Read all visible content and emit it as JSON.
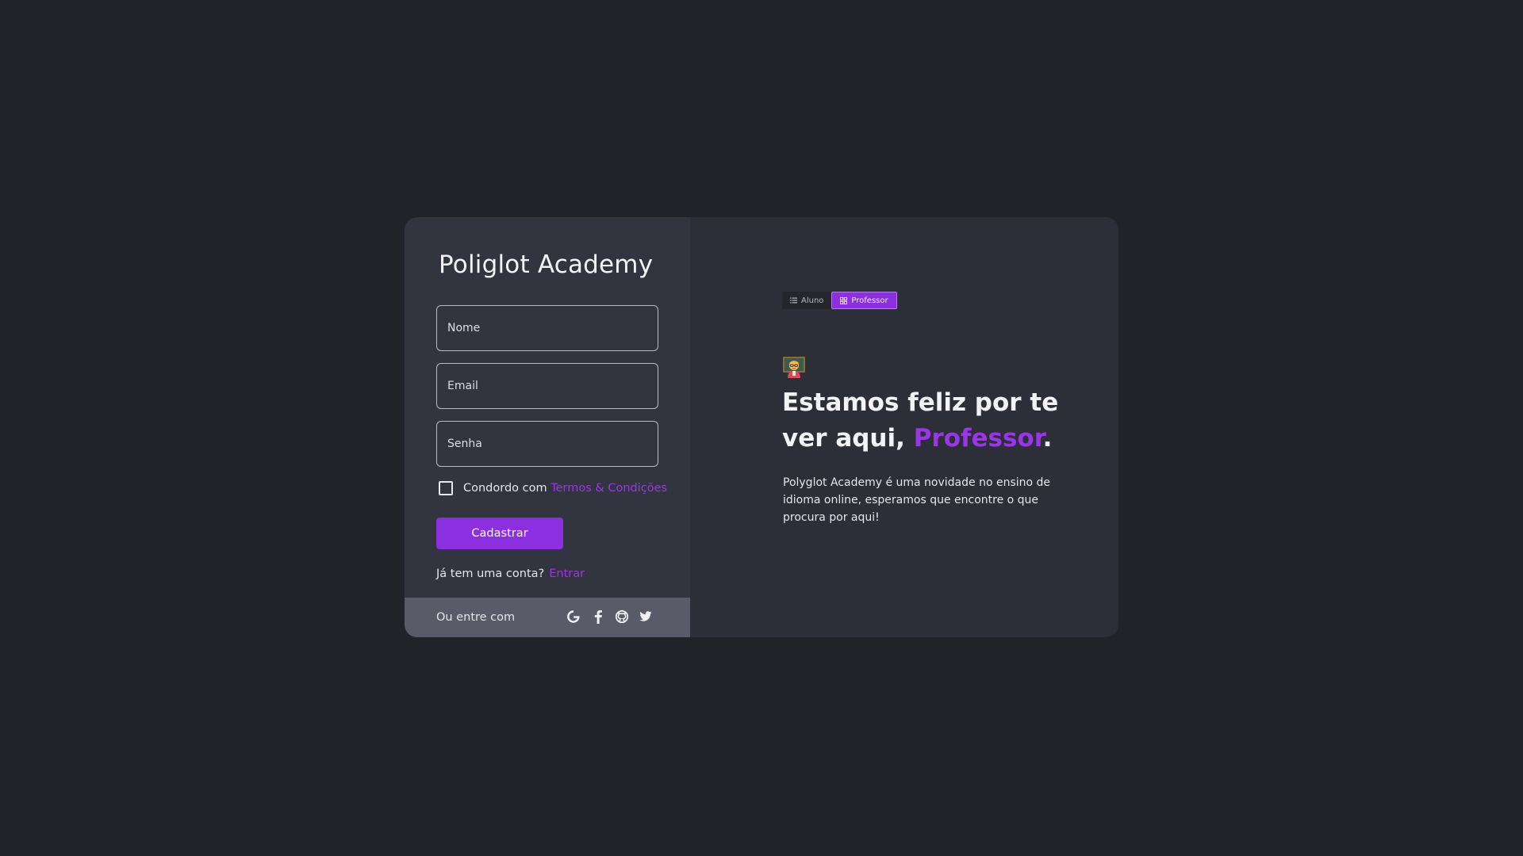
{
  "app_title": "Poliglot Academy",
  "form": {
    "name_placeholder": "Nome",
    "email_placeholder": "Email",
    "password_placeholder": "Senha",
    "terms_prefix": "Condordo com",
    "terms_link": "Termos & Condições",
    "submit_label": "Cadastrar",
    "login_prompt": "Já tem uma conta?",
    "login_link": "Entrar"
  },
  "social": {
    "label": "Ou entre com",
    "providers": [
      "google-icon",
      "facebook-icon",
      "github-icon",
      "twitter-icon"
    ]
  },
  "role_toggle": {
    "options": [
      {
        "label": "Aluno",
        "icon": "list-icon",
        "active": false
      },
      {
        "label": "Professor",
        "icon": "grid-icon",
        "active": true
      }
    ]
  },
  "welcome": {
    "emoji": "teacher-emoji",
    "headline_prefix": "Estamos feliz por te ver aqui, ",
    "headline_highlight": "Professor",
    "headline_suffix": ".",
    "description": "Polyglot Academy é uma novidade no ensino  de idioma online, esperamos que encontre o que procura por aqui!"
  },
  "colors": {
    "page_bg": "#202428",
    "left_panel_bg": "#32343f",
    "right_panel_bg": "#2c2f37",
    "footer_bg": "#5a5b68",
    "accent": "#8b2fe0",
    "accent_text": "#9b36e6"
  }
}
